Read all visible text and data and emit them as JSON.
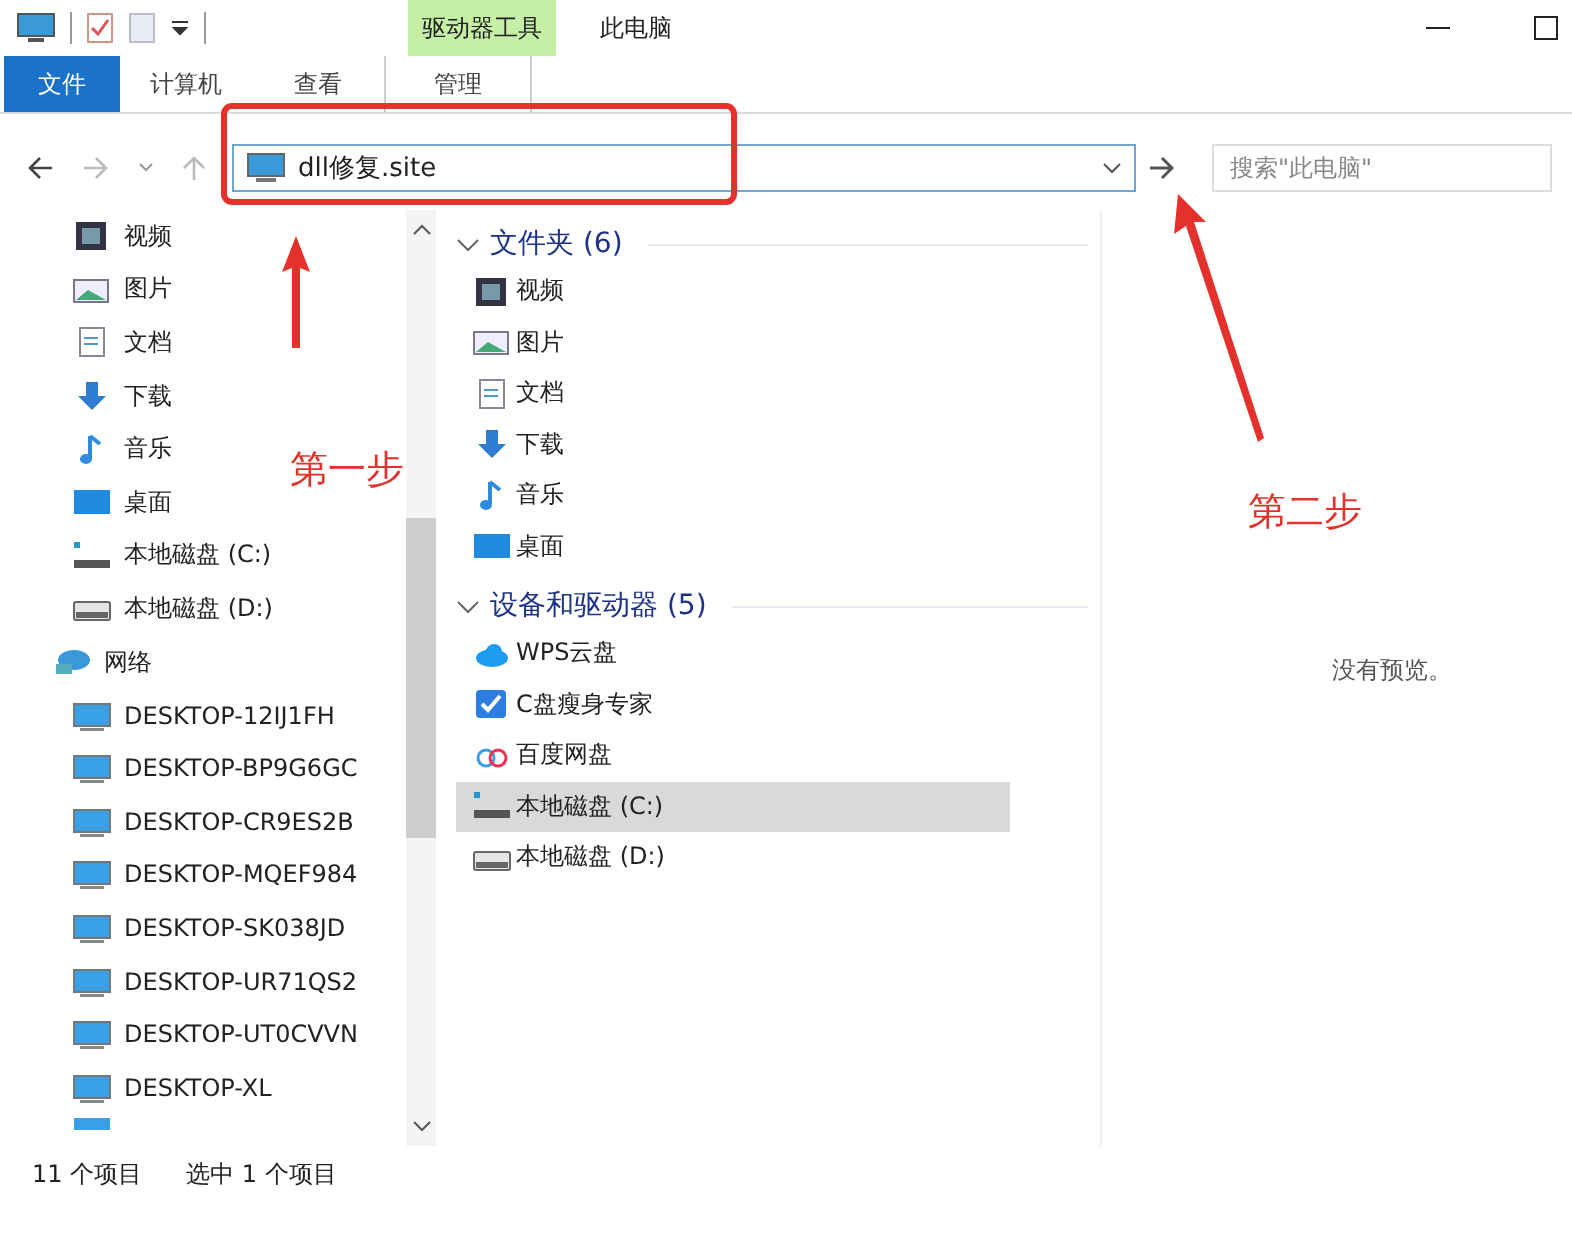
{
  "window": {
    "title": "此电脑",
    "context_group": "驱动器工具"
  },
  "tabs": [
    {
      "label": "文件",
      "selected": true,
      "kind": "file"
    },
    {
      "label": "计算机",
      "selected": false,
      "kind": "normal"
    },
    {
      "label": "查看",
      "selected": false,
      "kind": "normal"
    },
    {
      "label": "管理",
      "selected": false,
      "kind": "context"
    }
  ],
  "address": {
    "value": "dll修复.site"
  },
  "search": {
    "placeholder": "搜索\"此电脑\""
  },
  "sidebar": {
    "items": [
      {
        "label": "视频",
        "kind": "video"
      },
      {
        "label": "图片",
        "kind": "pictures"
      },
      {
        "label": "文档",
        "kind": "documents"
      },
      {
        "label": "下载",
        "kind": "downloads"
      },
      {
        "label": "音乐",
        "kind": "music"
      },
      {
        "label": "桌面",
        "kind": "desktop"
      },
      {
        "label": "本地磁盘 (C:)",
        "kind": "drive_c"
      },
      {
        "label": "本地磁盘 (D:)",
        "kind": "drive_d"
      },
      {
        "label": "网络",
        "kind": "network"
      },
      {
        "label": "DESKTOP-12IJ1FH",
        "kind": "pc"
      },
      {
        "label": "DESKTOP-BP9G6GC",
        "kind": "pc"
      },
      {
        "label": "DESKTOP-CR9ES2B",
        "kind": "pc"
      },
      {
        "label": "DESKTOP-MQEF984",
        "kind": "pc"
      },
      {
        "label": "DESKTOP-SK038JD",
        "kind": "pc"
      },
      {
        "label": "DESKTOP-UR71QS2",
        "kind": "pc"
      },
      {
        "label": "DESKTOP-UT0CVVN",
        "kind": "pc"
      },
      {
        "label": "DESKTOP-XL",
        "kind": "pc"
      }
    ]
  },
  "groups": [
    {
      "title": "文件夹 (6)",
      "expanded": true,
      "items": [
        {
          "label": "视频",
          "kind": "video",
          "selected": false
        },
        {
          "label": "图片",
          "kind": "pictures",
          "selected": false
        },
        {
          "label": "文档",
          "kind": "documents",
          "selected": false
        },
        {
          "label": "下载",
          "kind": "downloads",
          "selected": false
        },
        {
          "label": "音乐",
          "kind": "music",
          "selected": false
        },
        {
          "label": "桌面",
          "kind": "desktop",
          "selected": false
        }
      ]
    },
    {
      "title": "设备和驱动器 (5)",
      "expanded": true,
      "items": [
        {
          "label": "WPS云盘",
          "kind": "cloud",
          "selected": false
        },
        {
          "label": "C盘瘦身专家",
          "kind": "checkapp",
          "selected": false
        },
        {
          "label": "百度网盘",
          "kind": "baidu",
          "selected": false
        },
        {
          "label": "本地磁盘 (C:)",
          "kind": "drive_c",
          "selected": true
        },
        {
          "label": "本地磁盘 (D:)",
          "kind": "drive_d",
          "selected": false
        }
      ]
    }
  ],
  "preview": {
    "text": "没有预览。"
  },
  "status_bar": {
    "count": "11 个项目",
    "selection": "选中 1 个项目"
  },
  "annotations": [
    {
      "text": "第一步"
    },
    {
      "text": "第二步"
    }
  ]
}
